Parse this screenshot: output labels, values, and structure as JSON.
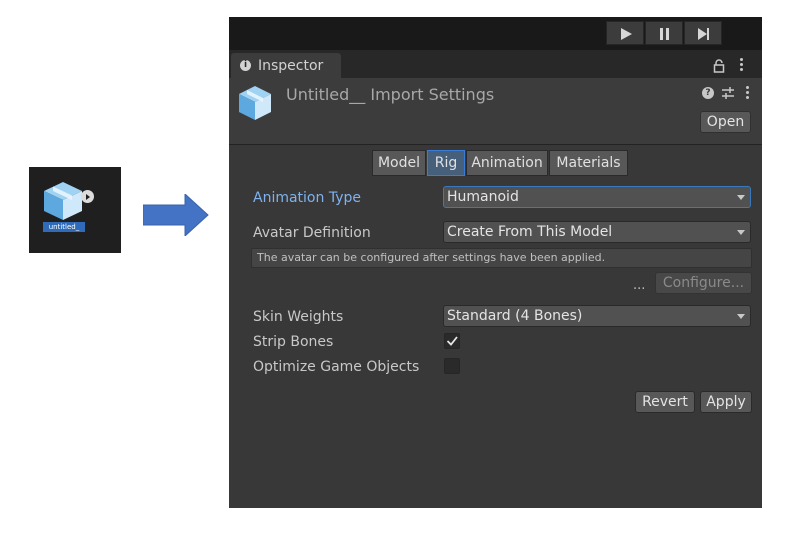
{
  "asset": {
    "label": "untitled_",
    "icon": "model-cube-icon"
  },
  "toolbar": {
    "play_icon": "play-icon",
    "pause_icon": "pause-icon",
    "step_icon": "step-icon"
  },
  "inspector_tab": {
    "label": "Inspector"
  },
  "header": {
    "title": "Untitled__ Import Settings",
    "open_label": "Open"
  },
  "tabs": [
    {
      "label": "Model",
      "active": false
    },
    {
      "label": "Rig",
      "active": true
    },
    {
      "label": "Animation",
      "active": false
    },
    {
      "label": "Materials",
      "active": false
    }
  ],
  "rig": {
    "animation_type": {
      "label": "Animation Type",
      "value": "Humanoid"
    },
    "avatar_definition": {
      "label": "Avatar Definition",
      "value": "Create From This Model"
    },
    "help_text": "The avatar can be configured after settings have been applied.",
    "ellipsis": "...",
    "configure_label": "Configure...",
    "skin_weights": {
      "label": "Skin Weights",
      "value": "Standard (4 Bones)"
    },
    "strip_bones": {
      "label": "Strip Bones",
      "checked": true
    },
    "optimize_game_objects": {
      "label": "Optimize Game Objects",
      "checked": false
    }
  },
  "footer": {
    "revert_label": "Revert",
    "apply_label": "Apply"
  },
  "colors": {
    "panel": "#383838",
    "accent": "#3a79bb",
    "label_highlight": "#7fb2ee"
  }
}
